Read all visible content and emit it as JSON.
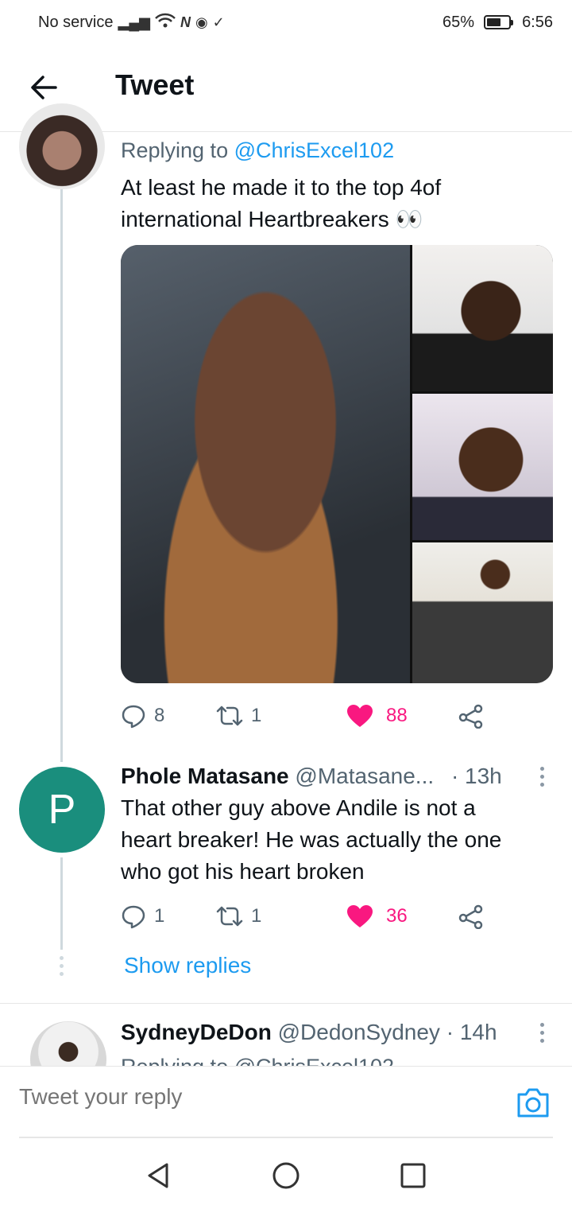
{
  "status_bar": {
    "carrier": "No service",
    "battery": "65%",
    "battery_level": 0.65,
    "time": "6:56"
  },
  "header": {
    "title": "Tweet"
  },
  "tweet1": {
    "replying_prefix": "Replying to",
    "replying_to": "@ChrisExcel102",
    "text_line1": "At least he made it to the top 4of",
    "text_line2": "international Heartbreakers 👀",
    "replies": "8",
    "retweets": "1",
    "likes": "88"
  },
  "tweet2": {
    "avatar_letter": "P",
    "name": "Phole Matasane",
    "handle": "@Matasane...",
    "time": "· 13h",
    "text_line1": "That other guy above Andile is not a",
    "text_line2": "heart breaker! He was actually the one",
    "text_line3": "who got his heart broken",
    "replies": "1",
    "retweets": "1",
    "likes": "36",
    "show_replies": "Show replies"
  },
  "tweet3": {
    "name": "SydneyDeDon",
    "handle": "@DedonSydney",
    "time": "· 14h",
    "replying_partial": "Replying to @ChrisExcel102"
  },
  "reply_bar": {
    "placeholder": "Tweet your reply"
  },
  "colors": {
    "accent": "#1d9bf0",
    "like": "#f91880",
    "avatar_p": "#1a8e7d"
  }
}
